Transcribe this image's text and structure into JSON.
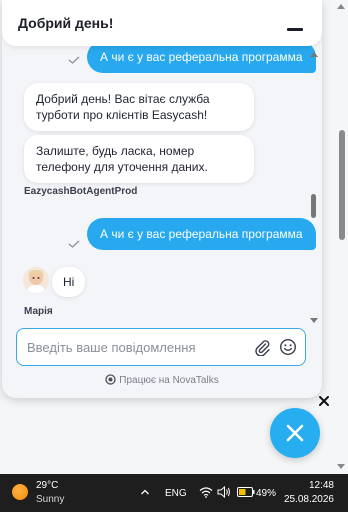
{
  "header": {
    "title": "Добрий день!"
  },
  "messages": [
    {
      "type": "user",
      "text": "А чи є у вас реферальна программа",
      "read": true
    },
    {
      "type": "bot",
      "text": "Добрий день! Вас вітає служба турботи про клієнтів Easycash!"
    },
    {
      "type": "bot",
      "text": "Залиште, будь ласка, номер телефону для уточення даних."
    },
    {
      "type": "sender",
      "text": "EazycashBotAgentProd"
    },
    {
      "type": "user",
      "text": "А чи є у вас реферальна программа",
      "read": true
    },
    {
      "type": "agent",
      "text": "Hi"
    },
    {
      "type": "sender",
      "text": "Марія"
    }
  ],
  "input": {
    "placeholder": "Введіть ваше повідомлення",
    "value": ""
  },
  "footer": {
    "powered_by": "Працює на NovaTalks"
  },
  "taskbar": {
    "weather_temp": "29°C",
    "weather_desc": "Sunny",
    "language": "ENG",
    "battery_percent": "49%",
    "time": "12:48",
    "date": "25.08.2026"
  },
  "colors": {
    "accent": "#28a8ee",
    "input_border": "#3aa6ee",
    "fab": "#26aef0"
  },
  "icons": [
    "minimize-icon",
    "check-icon",
    "attach-icon",
    "emoji-icon",
    "novatalks-logo-icon",
    "close-icon",
    "chat-close-icon",
    "weather-sun-icon",
    "chevron-up-icon",
    "wifi-icon",
    "volume-icon",
    "battery-icon"
  ]
}
